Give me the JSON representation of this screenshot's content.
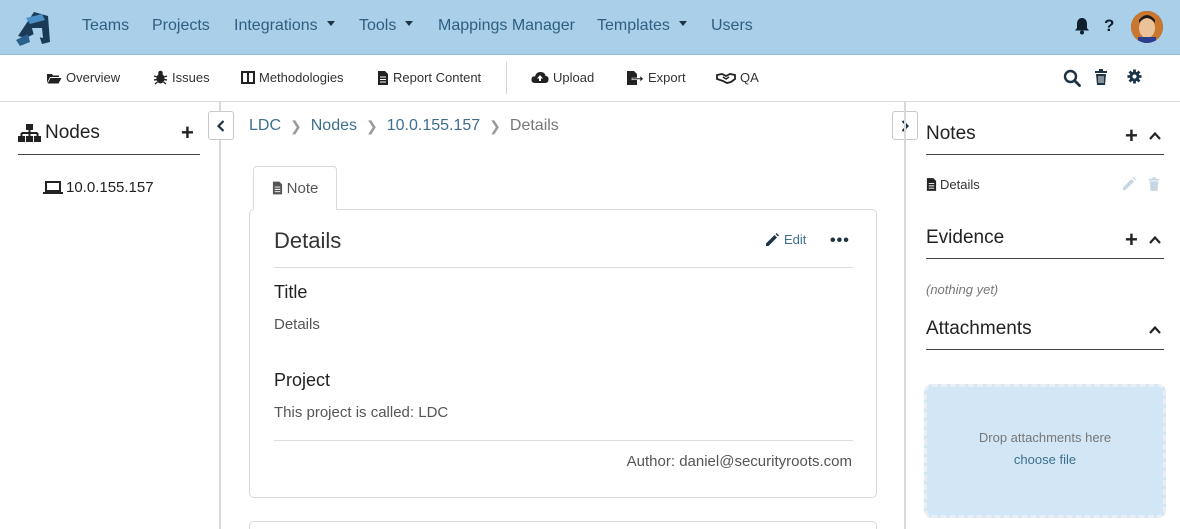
{
  "nav": {
    "teams": "Teams",
    "projects": "Projects",
    "integrations": "Integrations",
    "tools": "Tools",
    "mappings": "Mappings Manager",
    "templates": "Templates",
    "users": "Users",
    "help": "?"
  },
  "toolbar": {
    "overview": "Overview",
    "issues": "Issues",
    "methodologies": "Methodologies",
    "report_content": "Report Content",
    "upload": "Upload",
    "export": "Export",
    "qa": "QA"
  },
  "left": {
    "title": "Nodes",
    "nodes": [
      "10.0.155.157"
    ]
  },
  "breadcrumb": {
    "project": "LDC",
    "nodes": "Nodes",
    "node": "10.0.155.157",
    "current": "Details"
  },
  "note": {
    "tab_label": "Note",
    "title": "Details",
    "edit_label": "Edit",
    "more": "•••",
    "fields": [
      {
        "label": "Title",
        "value": "Details"
      },
      {
        "label": "Project",
        "value": "This project is called: LDC"
      }
    ],
    "author": "Author: daniel@securityroots.com"
  },
  "right": {
    "notes_title": "Notes",
    "notes": [
      "Details"
    ],
    "evidence_title": "Evidence",
    "evidence_empty": "(nothing yet)",
    "attachments_title": "Attachments",
    "drop_text": "Drop attachments here",
    "choose_file": "choose file"
  },
  "colors": {
    "topbar": "#a9cfe9",
    "link": "#3e6f8f",
    "dropzone": "#d2e6f5"
  }
}
